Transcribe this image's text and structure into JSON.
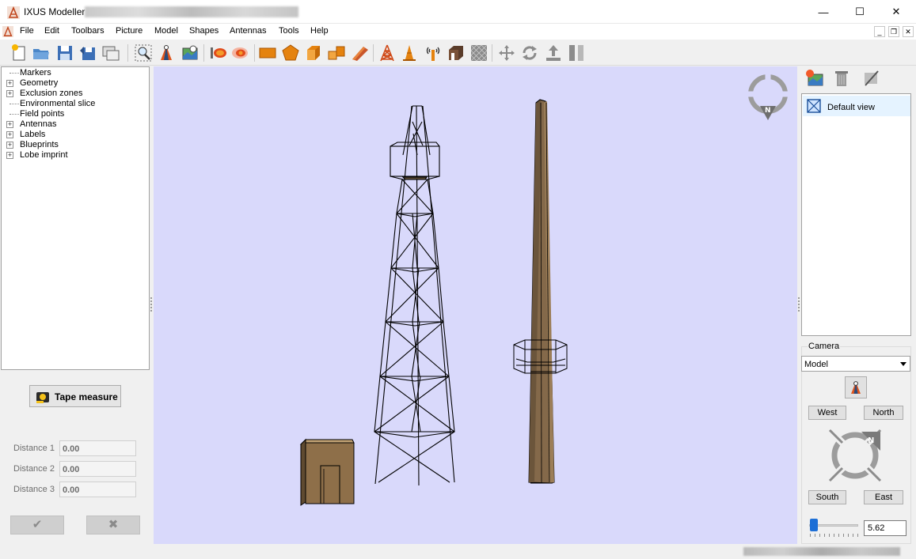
{
  "window": {
    "title": "IXUS Modeller",
    "controls": {
      "minimize": "—",
      "maximize": "☐",
      "close": "✕"
    }
  },
  "menu": {
    "items": [
      "File",
      "Edit",
      "Toolbars",
      "Picture",
      "Model",
      "Shapes",
      "Antennas",
      "Tools",
      "Help"
    ],
    "mdi": {
      "minimize": "_",
      "restore": "❐",
      "close": "✕"
    }
  },
  "toolbar": {
    "icons": [
      "new-file-icon",
      "open-folder-icon",
      "save-icon",
      "save-as-icon",
      "screenshots-icon",
      "zoom-select-icon",
      "place-tower-icon",
      "picture-view-icon",
      "lobe-icon",
      "lobe-imprint-icon",
      "box-shape-icon",
      "pentagon-shape-icon",
      "cube-shape-icon",
      "blocks-shape-icon",
      "roof-shape-icon",
      "lattice-tower-icon",
      "cone-tower-icon",
      "antenna-icon",
      "building-icon",
      "mesh-icon",
      "move-icon",
      "rotate-icon",
      "lift-icon",
      "split-icon"
    ]
  },
  "tree": {
    "items": [
      {
        "label": "Markers",
        "expandable": false
      },
      {
        "label": "Geometry",
        "expandable": true
      },
      {
        "label": "Exclusion zones",
        "expandable": true
      },
      {
        "label": "Environmental slice",
        "expandable": false
      },
      {
        "label": "Field points",
        "expandable": false
      },
      {
        "label": "Antennas",
        "expandable": true
      },
      {
        "label": "Labels",
        "expandable": true
      },
      {
        "label": "Blueprints",
        "expandable": true
      },
      {
        "label": "Lobe imprint",
        "expandable": true
      }
    ]
  },
  "measure": {
    "tape_label": "Tape measure",
    "distances": [
      {
        "label": "Distance 1",
        "value": "0.00"
      },
      {
        "label": "Distance 2",
        "value": "0.00"
      },
      {
        "label": "Distance 3",
        "value": "0.00"
      }
    ],
    "confirm_glyph": "✔",
    "cancel_glyph": "✖"
  },
  "views": {
    "tools": [
      "add-view-icon",
      "delete-view-icon",
      "edit-view-icon"
    ],
    "items": [
      {
        "label": "Default view",
        "selected": true
      }
    ]
  },
  "camera": {
    "group_title": "Camera",
    "mode": "Model",
    "buttons": {
      "west": "West",
      "north": "North",
      "south": "South",
      "east": "East"
    },
    "compass_letter": "N",
    "zoom_value": "5.62",
    "zoom_level": 0.05
  },
  "viewport": {
    "compass_letter": "N",
    "background": "#d9d9fb"
  }
}
